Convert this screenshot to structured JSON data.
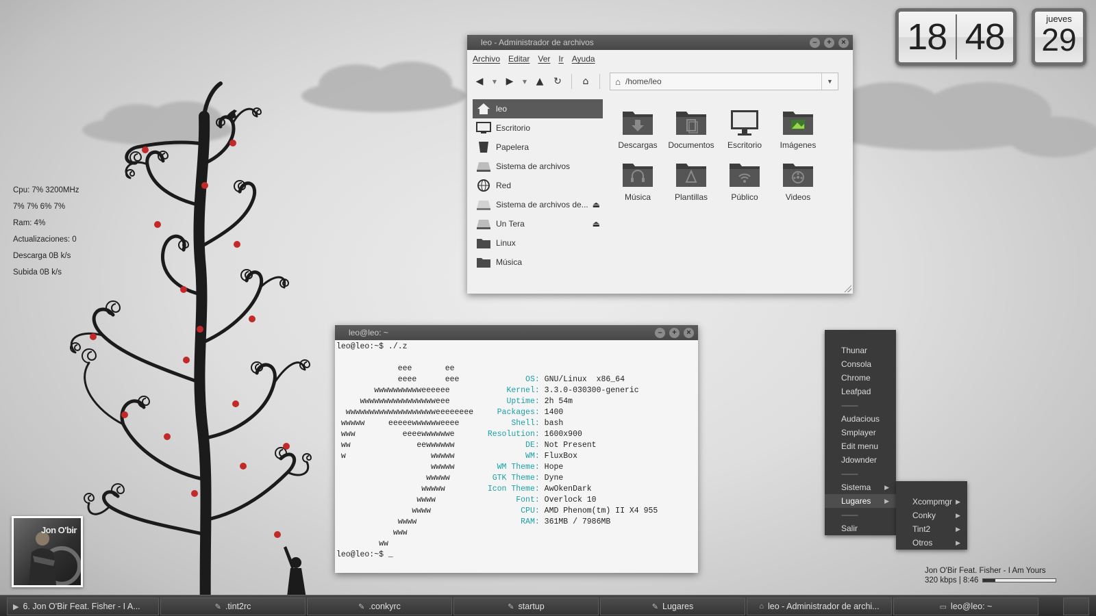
{
  "conky": {
    "cpu": "Cpu: 7% 3200MHz",
    "cores": "7% 7% 6% 7%",
    "ram": "Ram: 4%",
    "updates": "Actualizaciones: 0",
    "download": "Descarga 0B  k/s",
    "upload": "Subida 0B  k/s"
  },
  "clock": {
    "hours": "18",
    "minutes": "48"
  },
  "calendar": {
    "weekday": "jueves",
    "day": "29"
  },
  "file_manager": {
    "title": "leo - Administrador de archivos",
    "menu": [
      "Archivo",
      "Editar",
      "Ver",
      "Ir",
      "Ayuda"
    ],
    "path": "/home/leo",
    "sidebar": [
      {
        "label": "leo",
        "icon": "home-icon",
        "active": true
      },
      {
        "label": "Escritorio",
        "icon": "desktop-icon"
      },
      {
        "label": "Papelera",
        "icon": "trash-icon"
      },
      {
        "label": "Sistema de archivos",
        "icon": "drive-icon"
      },
      {
        "label": "Red",
        "icon": "network-globe-icon"
      },
      {
        "label": "Sistema de archivos de...",
        "icon": "drive-icon",
        "eject": true
      },
      {
        "label": "Un Tera",
        "icon": "drive-icon",
        "eject": true
      },
      {
        "label": "Linux",
        "icon": "folder-icon"
      },
      {
        "label": "Música",
        "icon": "folder-icon"
      }
    ],
    "items": [
      {
        "label": "Descargas",
        "icon": "download-folder-icon"
      },
      {
        "label": "Documentos",
        "icon": "documents-folder-icon"
      },
      {
        "label": "Escritorio",
        "icon": "monitor-icon"
      },
      {
        "label": "Imágenes",
        "icon": "images-folder-icon"
      },
      {
        "label": "Música",
        "icon": "music-folder-icon"
      },
      {
        "label": "Plantillas",
        "icon": "templates-folder-icon"
      },
      {
        "label": "Público",
        "icon": "public-folder-icon"
      },
      {
        "label": "Videos",
        "icon": "videos-folder-icon"
      }
    ]
  },
  "terminal": {
    "title": "leo@leo: ~",
    "prompt": "leo@leo:~$ ./.z",
    "final_prompt": "leo@leo:~$ _",
    "info": [
      {
        "key": "OS:",
        "value": "GNU/Linux  x86_64"
      },
      {
        "key": "Kernel:",
        "value": "3.3.0-030300-generic"
      },
      {
        "key": "Uptime:",
        "value": "2h 54m"
      },
      {
        "key": "Packages:",
        "value": "1400"
      },
      {
        "key": "Shell:",
        "value": "bash"
      },
      {
        "key": "Resolution:",
        "value": "1600x900"
      },
      {
        "key": "DE:",
        "value": "Not Present"
      },
      {
        "key": "WM:",
        "value": "FluxBox"
      },
      {
        "key": "WM Theme:",
        "value": "Hope"
      },
      {
        "key": "GTK Theme:",
        "value": "Dyne"
      },
      {
        "key": "Icon Theme:",
        "value": "AwOkenDark"
      },
      {
        "key": "Font:",
        "value": "Overlock 10"
      },
      {
        "key": "CPU:",
        "value": "AMD Phenom(tm) II X4 955"
      },
      {
        "key": "RAM:",
        "value": "361MB / 7986MB"
      }
    ],
    "art": [
      "",
      "             eee       ee",
      "             eeee      eee",
      "        wwwwwwwwwweeeeee",
      "     wwwwwwwwwwwwwwwweee",
      "  wwwwwwwwwwwwwwwwwwweeeeeeee",
      " wwwww     eeeeewwwwwweeee",
      " www          eeeewwwwwwe",
      " ww              eewwwwww",
      " w                  wwwww",
      "                    wwwww",
      "                   wwwww",
      "                  wwwww",
      "                 wwww",
      "                wwww",
      "             wwww",
      "            www",
      "         ww"
    ]
  },
  "root_menu": {
    "items": [
      "Thunar",
      "Consola",
      "Chrome",
      "Leafpad",
      "--------",
      "Audacious",
      "Smplayer",
      "Edit menu",
      "Jdownder",
      "--------",
      "Sistema",
      "Lugares",
      "--------",
      "Salir"
    ],
    "submenu_parents": [
      "Sistema",
      "Lugares"
    ],
    "active": "Lugares",
    "submenu": [
      "Xcompmgr",
      "Conky",
      "Tint2",
      "Otros"
    ]
  },
  "album": {
    "artist_text": "Jon O'bir"
  },
  "now_playing": {
    "track": "Jon O'Bir Feat. Fisher - I Am Yours",
    "status": "320 kbps | 8:46",
    "progress": 0.17
  },
  "taskbar": [
    {
      "label": "6. Jon O'Bir Feat. Fisher - I A...",
      "icon": "play-icon"
    },
    {
      "label": ".tint2rc",
      "icon": "pencil-icon"
    },
    {
      "label": ".conkyrc",
      "icon": "pencil-icon"
    },
    {
      "label": "startup",
      "icon": "pencil-icon"
    },
    {
      "label": "Lugares",
      "icon": "pencil-icon"
    },
    {
      "label": "leo - Administrador de archi...",
      "icon": "home-icon"
    },
    {
      "label": "leo@leo: ~",
      "icon": "terminal-icon"
    }
  ],
  "colors": {
    "terminal_key": "#1aa0a8",
    "berry": "#c22a2a",
    "tree": "#1b1b1b"
  }
}
